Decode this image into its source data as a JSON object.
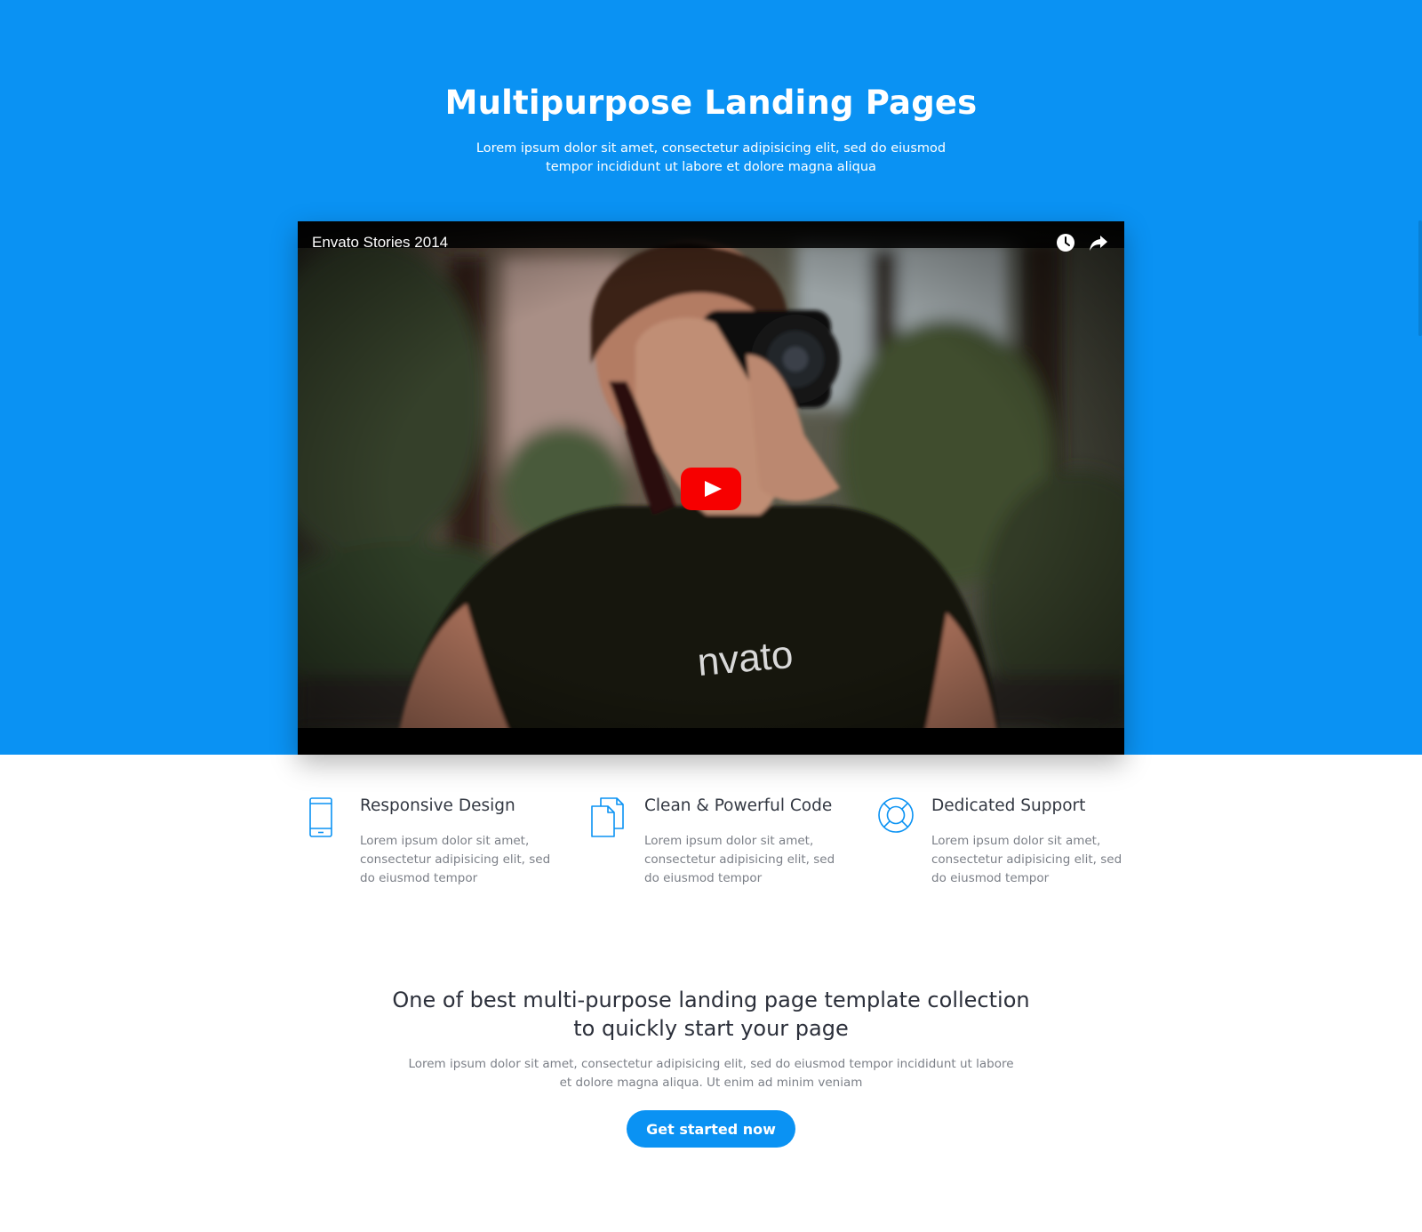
{
  "theme": {
    "accent": "#0a92f3",
    "play_button": "#f70000",
    "heading": "#2b2f3a",
    "muted": "#7b7f87"
  },
  "hero": {
    "title": "Multipurpose Landing Pages",
    "subtitle": "Lorem ipsum dolor sit amet, consectetur adipisicing elit, sed do eiusmod tempor incididunt ut labore et dolore magna aliqua"
  },
  "video": {
    "title": "Envato Stories 2014",
    "shirt_text": "nvato",
    "controls": {
      "watch_later_icon": "clock-icon",
      "share_icon": "share-arrow-icon",
      "play_icon": "youtube-play-icon"
    }
  },
  "features": [
    {
      "icon": "mobile-phone-icon",
      "title": "Responsive Design",
      "description": "Lorem ipsum dolor sit amet, consectetur adipisicing elit, sed do eiusmod tempor"
    },
    {
      "icon": "documents-icon",
      "title": "Clean & Powerful Code",
      "description": "Lorem ipsum dolor sit amet, consectetur adipisicing elit, sed do eiusmod tempor"
    },
    {
      "icon": "lifebuoy-icon",
      "title": "Dedicated Support",
      "description": "Lorem ipsum dolor sit amet, consectetur adipisicing elit, sed do eiusmod tempor"
    }
  ],
  "cta": {
    "heading": "One of best multi-purpose landing page template collection to quickly start your page",
    "text": "Lorem ipsum dolor sit amet, consectetur adipisicing elit, sed do eiusmod tempor incididunt ut labore et dolore magna aliqua. Ut enim ad minim veniam",
    "button_label": "Get started now"
  }
}
